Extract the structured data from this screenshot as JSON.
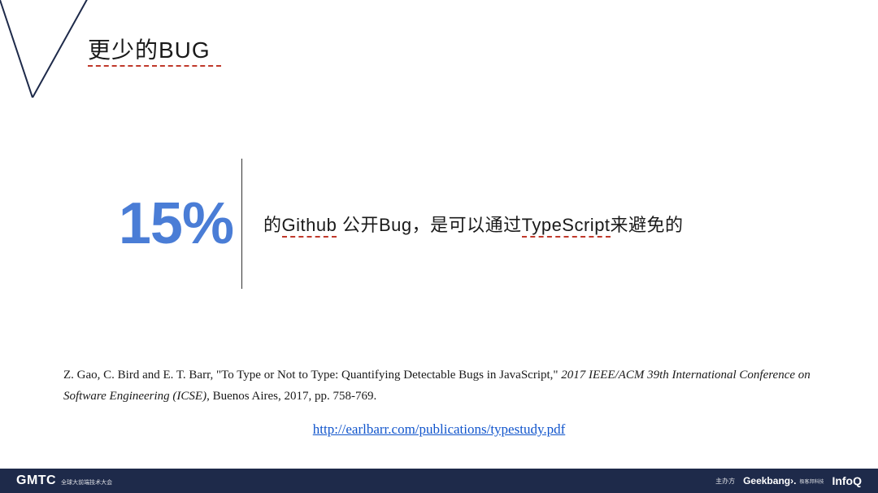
{
  "title": "更少的BUG",
  "stat": {
    "value": "15%",
    "desc_prefix": "的",
    "desc_word1": "Github",
    "desc_mid": " 公开Bug，是可以通过",
    "desc_word2": "TypeScript",
    "desc_suffix": "来避免的"
  },
  "citation": {
    "authors_title": "Z. Gao, C. Bird and E. T. Barr, \"To Type or Not to Type: Quantifying Detectable Bugs in JavaScript,\" ",
    "venue": "2017 IEEE/ACM 39th International Conference on Software Engineering (ICSE)",
    "rest": ", Buenos Aires, 2017, pp. 758-769.",
    "link": "http://earlbarr.com/publications/typestudy.pdf"
  },
  "footer": {
    "logo": "GMTC",
    "sub": "全球大前端技术大会",
    "host_label": "主办方",
    "brand1": "Geekbang›.",
    "brand1_sub": "极客邦科技",
    "brand2": "InfoQ"
  },
  "chart_data": {
    "type": "table",
    "title": "更少的BUG",
    "data": [
      {
        "metric": "Github 公开Bug 可以通过 TypeScript 避免的比例",
        "value_percent": 15
      }
    ],
    "source": "Z. Gao, C. Bird and E. T. Barr, \"To Type or Not to Type: Quantifying Detectable Bugs in JavaScript,\" 2017 IEEE/ACM 39th International Conference on Software Engineering (ICSE), Buenos Aires, 2017, pp. 758-769.",
    "link": "http://earlbarr.com/publications/typestudy.pdf"
  }
}
